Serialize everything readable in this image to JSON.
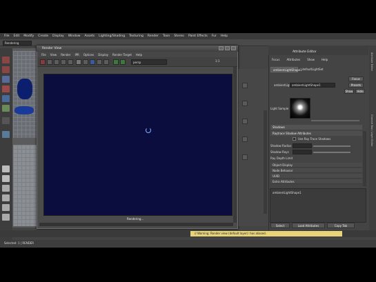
{
  "app": {
    "mode": "Rendering",
    "menus": [
      "File",
      "Edit",
      "Modify",
      "Create",
      "Display",
      "Window",
      "Assets",
      "Lighting/Shading",
      "Texturing",
      "Render",
      "Toon",
      "Stereo",
      "Paint Effects",
      "Fur",
      "Help"
    ]
  },
  "render_view": {
    "title": "Render View",
    "menus": [
      "File",
      "View",
      "Render",
      "IPR",
      "Options",
      "Display",
      "Render Target",
      "Help"
    ],
    "camera": "persp",
    "zoom": "1:1",
    "status": "Rendering..."
  },
  "attribute_editor": {
    "title": "Attribute Editor",
    "menus": [
      "Focus",
      "Attributes",
      "Show",
      "Help"
    ],
    "tabs": [
      "ambientLightShape1",
      "defaultLightSet"
    ],
    "node_label": "ambientLight:",
    "node_name": "ambientLightShape1",
    "buttons": [
      "Focus",
      "Presets",
      "Show",
      "Hide"
    ],
    "sample_label": "Light Sample",
    "sections": {
      "shadows": "Shadows",
      "raytrace": "Raytrace Shadow Attributes",
      "use_ray_trace": "Use Ray Trace Shadows",
      "shadow_radius": "Shadow Radius",
      "shadow_rays": "Shadow Rays",
      "ray_depth_limit": "Ray Depth Limit",
      "rows": [
        "Object Display",
        "Node Behavior",
        "UUID",
        "Extra Attributes"
      ]
    },
    "notes": "ambientLightShape1",
    "bottom_buttons": [
      "Select",
      "Load Attributes",
      "Copy Tab"
    ]
  },
  "side_tabs": [
    "Attribute Editor",
    "Channel Box / Layer Editor"
  ],
  "warning": "// Warning: Render view (default layer): has aliased.",
  "help": "Selected: 1 | RENDER"
}
